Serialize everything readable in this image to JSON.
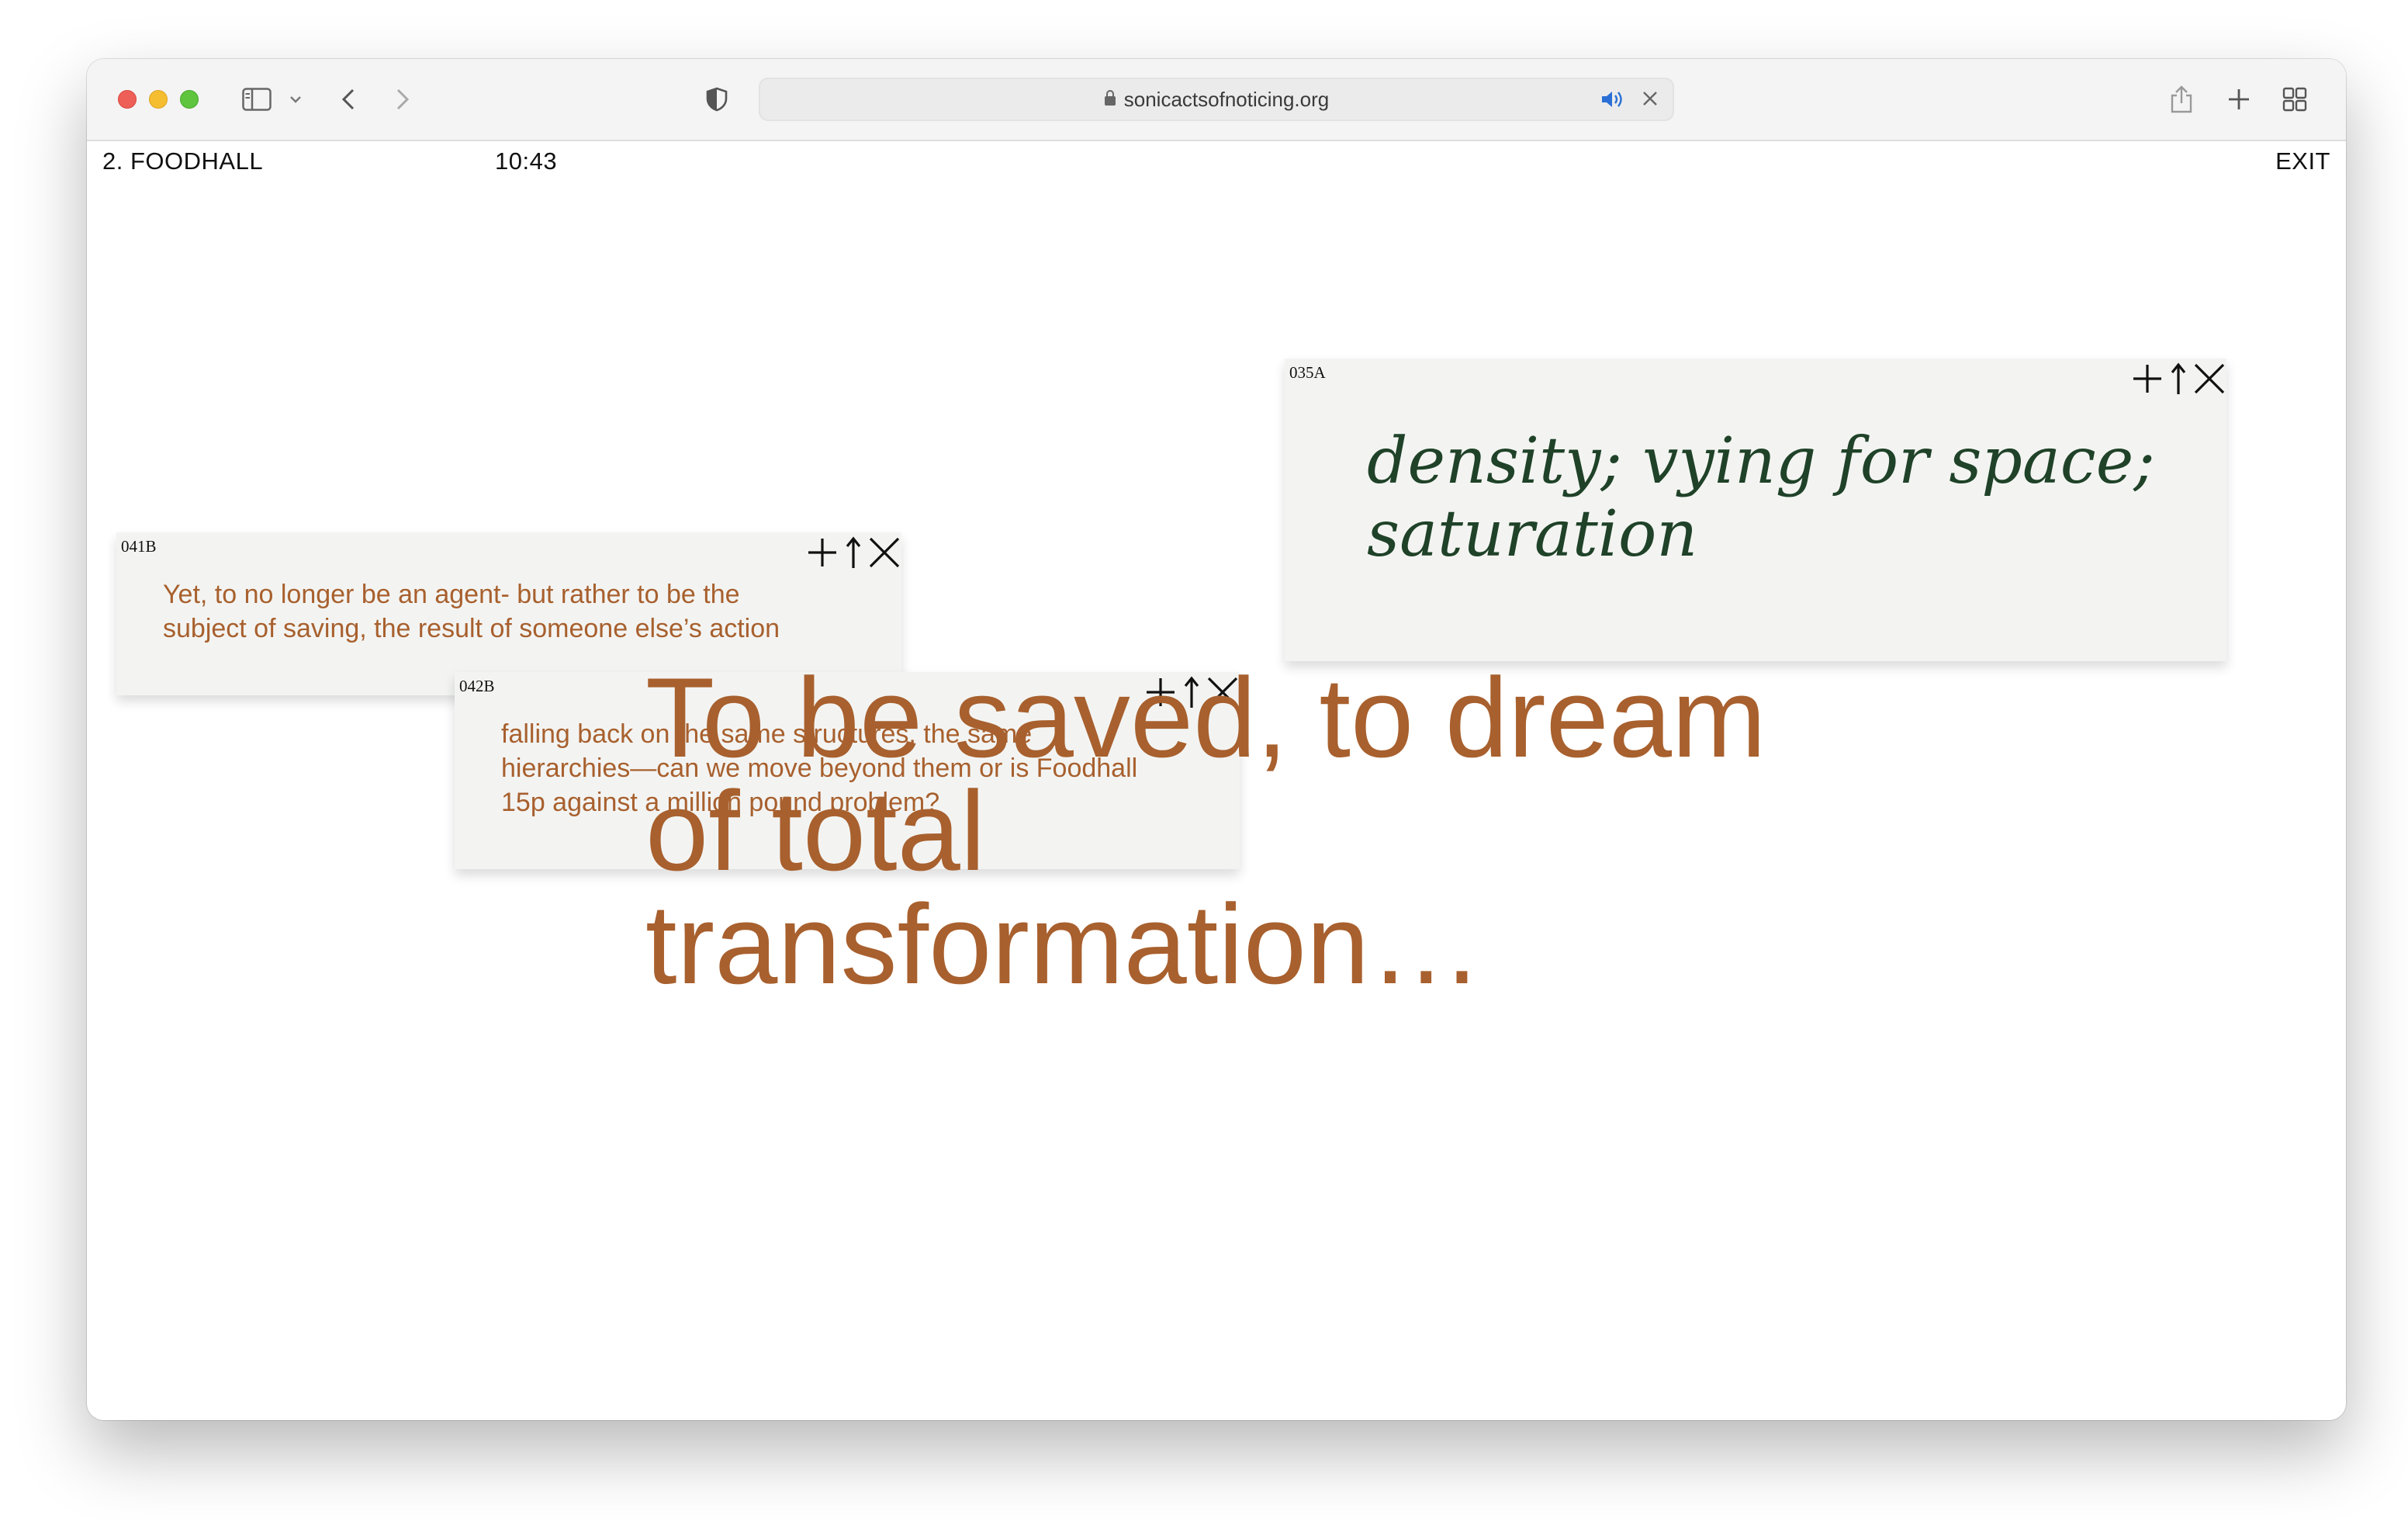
{
  "browser": {
    "url": "sonicactsofnoticing.org",
    "icons": [
      "sidebar-icon",
      "chevron-down-icon",
      "back-icon",
      "forward-icon",
      "shield-icon",
      "lock-icon",
      "speaker-icon",
      "close-icon",
      "share-icon",
      "new-tab-icon",
      "tab-overview-icon"
    ]
  },
  "header": {
    "section": "2. FOODHALL",
    "time": "10:43",
    "exit": "EXIT"
  },
  "cards": {
    "c035a": {
      "id": "035A",
      "text_line1": "density; vying for space;",
      "text_line2": "saturation"
    },
    "c041b": {
      "id": "041B",
      "text_line1": "Yet, to no longer be an agent- but rather to be the",
      "text_line2": "subject of saving, the result of someone else’s action"
    },
    "c042b": {
      "id": "042B",
      "text_line1": "falling back on the same structures, the same",
      "text_line2": "hierarchies—can we move beyond them or is Foodhall",
      "text_line3": "15p against a million pound problem?"
    }
  },
  "quote": {
    "line1": "To be saved, to dream",
    "line2": "of total",
    "line3": "transformation…"
  },
  "colors": {
    "accent_brown": "#a8602e",
    "accent_green": "#1f4228",
    "card_bg": "#f3f4f2"
  }
}
